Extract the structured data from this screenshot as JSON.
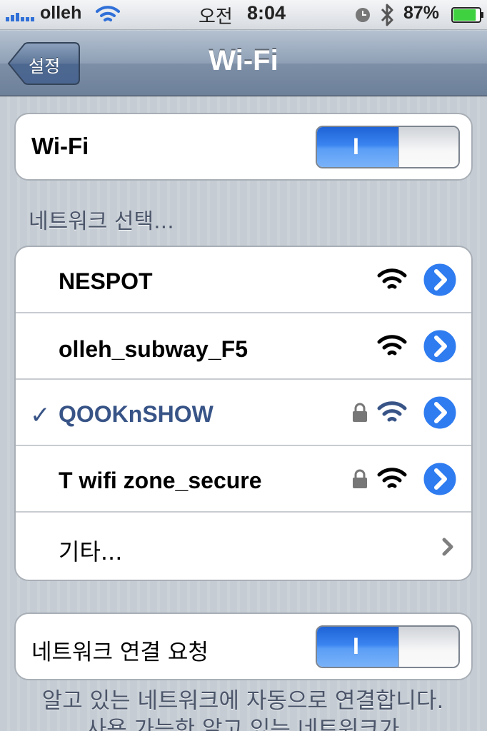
{
  "status_bar": {
    "carrier": "olleh",
    "ampm": "오전",
    "time": "8:04",
    "battery_percent": "87%",
    "signal_icon": "signal-bars-icon",
    "wifi_icon": "wifi-icon",
    "alarm_icon": "clock-icon",
    "bluetooth_icon": "bluetooth-icon",
    "battery_icon": "battery-icon",
    "battery_level": 0.87,
    "battery_color": "#3fd13f"
  },
  "nav": {
    "back_label": "설정",
    "title": "Wi-Fi"
  },
  "wifi_toggle": {
    "label": "Wi-Fi",
    "state": "on",
    "on_symbol": "I"
  },
  "network_section": {
    "header": "네트워크 선택...",
    "networks": [
      {
        "name": "NESPOT",
        "selected": false,
        "locked": false
      },
      {
        "name": "olleh_subway_F5",
        "selected": false,
        "locked": false
      },
      {
        "name": "QOOKnSHOW",
        "selected": true,
        "locked": true,
        "checkmark": "✓"
      },
      {
        "name": "T wifi zone_secure",
        "selected": false,
        "locked": true
      }
    ],
    "other_label": "기타..."
  },
  "ask_to_join": {
    "label": "네트워크 연결 요청",
    "state": "on",
    "on_symbol": "I"
  },
  "footer": {
    "text": "알고 있는 네트워크에 자동으로 연결합니다. 사용 가능한 알고 있는 네트워크가"
  },
  "colors": {
    "accent_blue": "#2f7cf0",
    "selected_text": "#385487",
    "nav_bar": "#7d8fa6"
  }
}
